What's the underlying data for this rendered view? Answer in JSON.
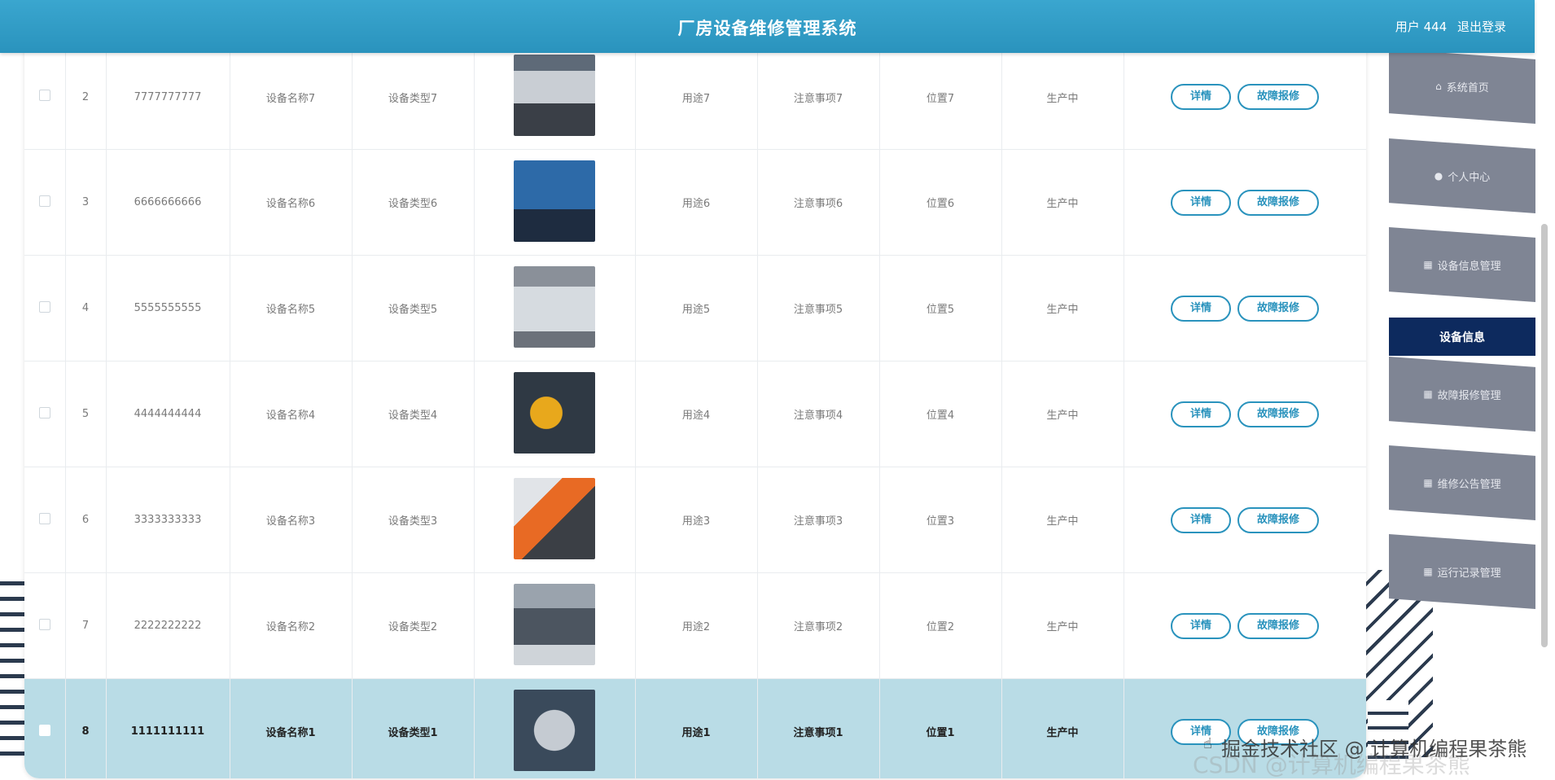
{
  "header": {
    "title": "厂房设备维修管理系统",
    "user_label": "用户 444",
    "logout_label": "退出登录"
  },
  "sidebar": {
    "items": [
      {
        "label": "系统首页",
        "icon": "home-icon"
      },
      {
        "label": "个人中心",
        "icon": "user-icon"
      },
      {
        "label": "设备信息管理",
        "icon": "grid-icon"
      },
      {
        "label": "故障报修管理",
        "icon": "grid-icon"
      },
      {
        "label": "维修公告管理",
        "icon": "grid-icon"
      },
      {
        "label": "运行记录管理",
        "icon": "grid-icon"
      }
    ],
    "active_item": "设备信息"
  },
  "table": {
    "detail_label": "详情",
    "repair_label": "故障报修",
    "rows": [
      {
        "index": "2",
        "code": "7777777777",
        "name": "设备名称7",
        "type": "设备类型7",
        "image_icon": "vacuum-machine-image",
        "usage": "用途7",
        "notes": "注意事项7",
        "location": "位置7",
        "status": "生产中"
      },
      {
        "index": "3",
        "code": "6666666666",
        "name": "设备名称6",
        "type": "设备类型6",
        "image_icon": "press-machine-image",
        "usage": "用途6",
        "notes": "注意事项6",
        "location": "位置6",
        "status": "生产中"
      },
      {
        "index": "4",
        "code": "5555555555",
        "name": "设备名称5",
        "type": "设备类型5",
        "image_icon": "cnc-machine-image",
        "usage": "用途5",
        "notes": "注意事项5",
        "location": "位置5",
        "status": "生产中"
      },
      {
        "index": "5",
        "code": "4444444444",
        "name": "设备名称4",
        "type": "设备类型4",
        "image_icon": "robot-arm-image",
        "usage": "用途4",
        "notes": "注意事项4",
        "location": "位置4",
        "status": "生产中"
      },
      {
        "index": "6",
        "code": "3333333333",
        "name": "设备名称3",
        "type": "设备类型3",
        "image_icon": "orange-robot-image",
        "usage": "用途3",
        "notes": "注意事项3",
        "location": "位置3",
        "status": "生产中"
      },
      {
        "index": "7",
        "code": "2222222222",
        "name": "设备名称2",
        "type": "设备类型2",
        "image_icon": "milling-machine-image",
        "usage": "用途2",
        "notes": "注意事项2",
        "location": "位置2",
        "status": "生产中"
      },
      {
        "index": "8",
        "code": "1111111111",
        "name": "设备名称1",
        "type": "设备类型1",
        "image_icon": "turbine-image",
        "usage": "用途1",
        "notes": "注意事项1",
        "location": "位置1",
        "status": "生产中"
      }
    ]
  },
  "watermark": "掘金技术社区 @ 计算机编程果茶熊",
  "watermark_faint": "CSDN @计算机编程果茶熊"
}
